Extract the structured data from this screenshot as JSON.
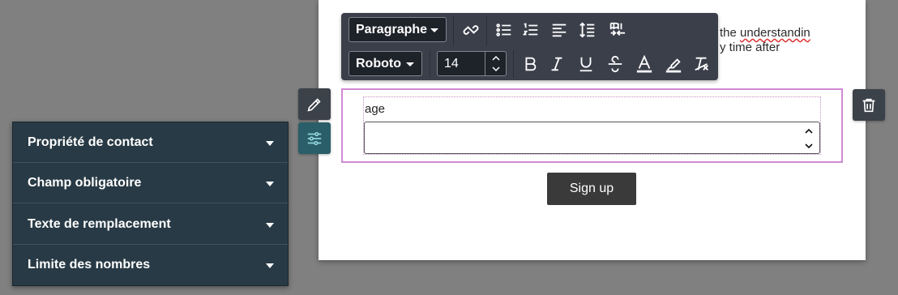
{
  "background_text": {
    "line1_prefix": "the ",
    "line1_word": "understandin",
    "line2": "y time after"
  },
  "toolbar": {
    "block_format": "Paragraphe",
    "font_family": "Roboto",
    "font_size": "14",
    "icons": [
      "unlink-icon",
      "bullet-list-icon",
      "numbered-list-icon",
      "align-left-icon",
      "line-height-icon",
      "text-direction-icon",
      "bold-icon",
      "italic-icon",
      "underline-icon",
      "strikethrough-icon",
      "font-color-icon",
      "highlight-icon",
      "clear-format-icon"
    ]
  },
  "form": {
    "field_label": "age",
    "field_value": "",
    "submit_label": "Sign up"
  },
  "panel": {
    "items": [
      {
        "label": "Propriété de contact"
      },
      {
        "label": "Champ obligatoire"
      },
      {
        "label": "Texte de remplacement"
      },
      {
        "label": "Limite des nombres"
      }
    ]
  },
  "colors": {
    "page_bg": "#808080",
    "toolbar_bg": "#3b3f4a",
    "panel_bg": "#283a45",
    "selection_border": "#d08ad6",
    "active_button": "#2a5e68"
  }
}
